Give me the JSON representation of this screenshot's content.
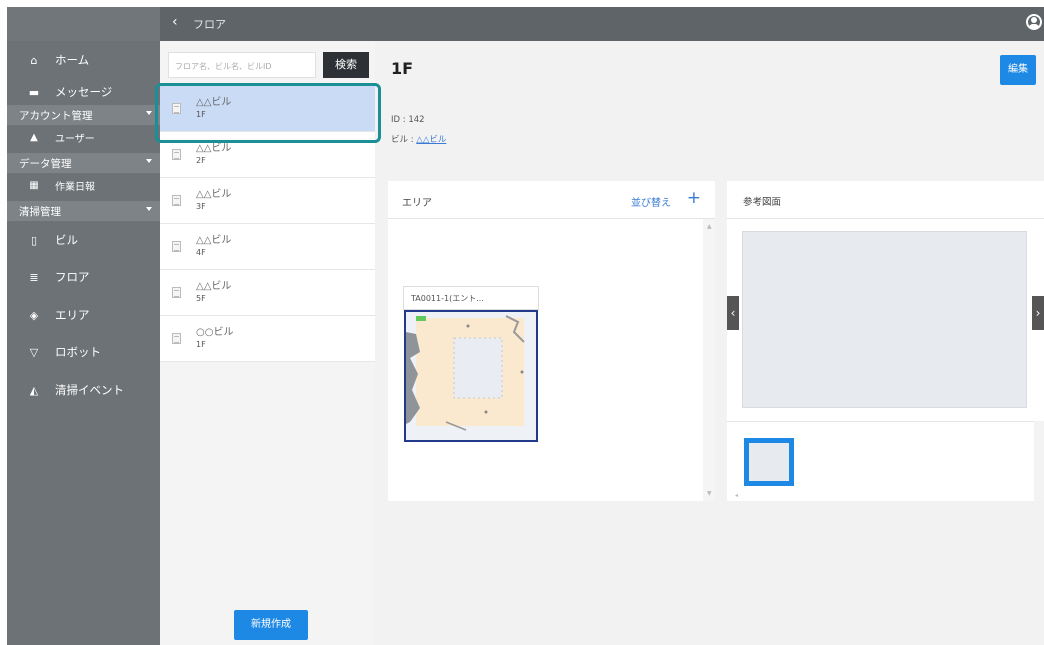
{
  "header": {
    "back_icon": "chevron-left-icon",
    "title": "フロア",
    "user_icon": "user-circle-icon"
  },
  "sidebar": {
    "items": [
      {
        "icon": "home-icon",
        "glyph": "⌂",
        "label": "ホーム"
      },
      {
        "icon": "message-icon",
        "glyph": "▬",
        "label": "メッセージ"
      }
    ],
    "group_account": "アカウント管理",
    "account_items": [
      {
        "icon": "user-icon",
        "glyph": "▲",
        "label": "ユーザー"
      }
    ],
    "group_data": "データ管理",
    "data_items": [
      {
        "icon": "report-icon",
        "glyph": "▦",
        "label": "作業日報"
      }
    ],
    "group_cleaning": "清掃管理",
    "cleaning_items": [
      {
        "icon": "building-icon",
        "glyph": "▯",
        "label": "ビル"
      },
      {
        "icon": "floor-icon",
        "glyph": "≣",
        "label": "フロア"
      },
      {
        "icon": "area-icon",
        "glyph": "◈",
        "label": "エリア"
      },
      {
        "icon": "robot-icon",
        "glyph": "▽",
        "label": "ロボット"
      },
      {
        "icon": "event-icon",
        "glyph": "◭",
        "label": "清掃イベント"
      }
    ]
  },
  "search": {
    "placeholder": "フロア名、ビル名、ビルID",
    "button": "検索"
  },
  "floors": [
    {
      "building": "△△ビル",
      "floor": "1F",
      "selected": true
    },
    {
      "building": "△△ビル",
      "floor": "2F"
    },
    {
      "building": "△△ビル",
      "floor": "3F"
    },
    {
      "building": "△△ビル",
      "floor": "4F"
    },
    {
      "building": "△△ビル",
      "floor": "5F"
    },
    {
      "building": "○○ビル",
      "floor": "1F"
    }
  ],
  "new_button": "新規作成",
  "main": {
    "title": "1F",
    "edit_button": "編集",
    "id_label": "ID : 142",
    "building_prefix": "ビル : ",
    "building_link": "△△ビル"
  },
  "area_panel": {
    "title": "エリア",
    "sort_label": "並び替え",
    "add_icon": "plus-icon",
    "area_name": "TA0011-1(エント..."
  },
  "ref_panel": {
    "title": "参考図面"
  },
  "colors": {
    "accent": "#1e88e5",
    "topbar": "#5e6468",
    "sidebar": "#6c7276",
    "selected_row": "#c9dbf5",
    "highlight_ring": "#1a8f96"
  }
}
